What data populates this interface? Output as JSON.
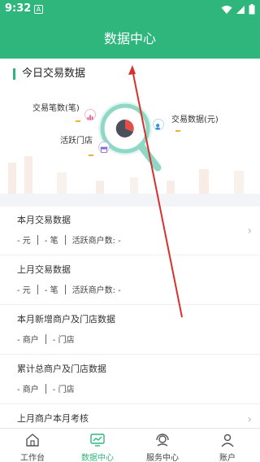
{
  "status_bar": {
    "time": "9:32",
    "notif": "A"
  },
  "header": {
    "title": "数据中心"
  },
  "hero": {
    "title": "今日交易数据",
    "label_count": "交易笔数(笔)",
    "label_amount": "交易数据(元)",
    "label_stores": "活跃门店"
  },
  "list": [
    {
      "title": "本月交易数据",
      "stats": [
        "- 元",
        "- 笔",
        "活跃商户数: -"
      ]
    },
    {
      "title": "上月交易数据",
      "stats": [
        "- 元",
        "- 笔",
        "活跃商户数: -"
      ]
    },
    {
      "title": "本月新增商户及门店数据",
      "stats": [
        "- 商户",
        "- 门店"
      ]
    },
    {
      "title": "累计总商户及门店数据",
      "stats": [
        "- 商户",
        "- 门店"
      ]
    },
    {
      "title": "上月商户本月考核",
      "stats": []
    }
  ],
  "tabs": [
    {
      "label": "工作台",
      "icon": "home-icon",
      "active": false
    },
    {
      "label": "数据中心",
      "icon": "chart-icon",
      "active": true
    },
    {
      "label": "服务中心",
      "icon": "headset-icon",
      "active": false
    },
    {
      "label": "账户",
      "icon": "user-icon",
      "active": false
    }
  ],
  "colors": {
    "brand": "#2eb67d",
    "annotation": "#d9302b"
  }
}
